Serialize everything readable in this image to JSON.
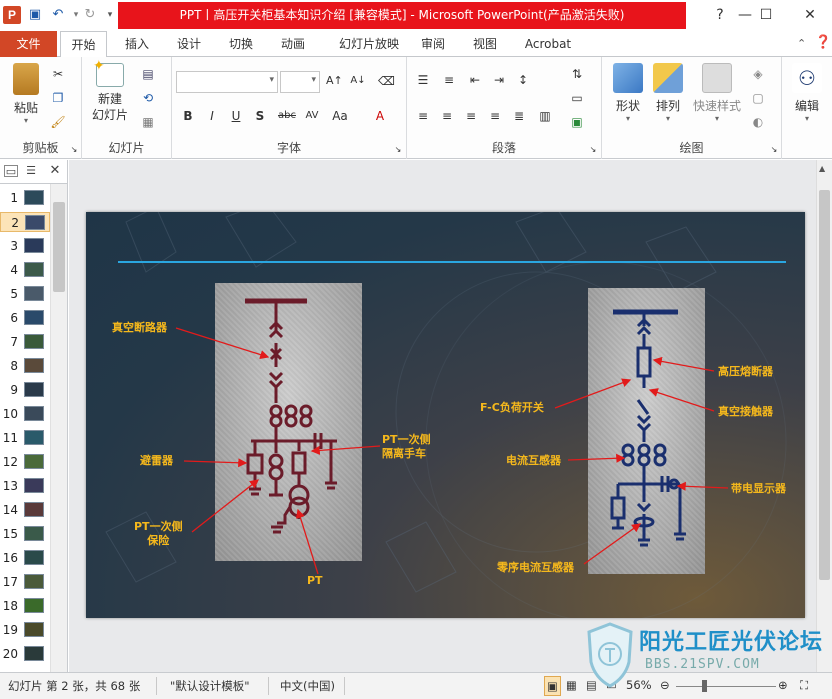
{
  "window": {
    "title": "PPT丨高压开关柜基本知识介绍 [兼容模式] - Microsoft PowerPoint(产品激活失败)",
    "app_icon": "P"
  },
  "ribbon": {
    "file_tab": "文件",
    "tabs": [
      "开始",
      "插入",
      "设计",
      "切换",
      "动画",
      "幻灯片放映",
      "审阅",
      "视图",
      "Acrobat"
    ],
    "active_tab": "开始",
    "groups": {
      "clipboard": {
        "label": "剪贴板",
        "paste": "粘贴"
      },
      "slides": {
        "label": "幻灯片",
        "new_slide": "新建\n幻灯片"
      },
      "font": {
        "label": "字体"
      },
      "paragraph": {
        "label": "段落"
      },
      "drawing": {
        "label": "绘图",
        "shape": "形状",
        "arrange": "排列",
        "quick_styles": "快速样式"
      },
      "editing": {
        "label": "编辑",
        "edit": "编辑"
      }
    }
  },
  "slide_pane": {
    "thumbnails": [
      "1",
      "2",
      "3",
      "4",
      "5",
      "6",
      "7",
      "8",
      "9",
      "10",
      "11",
      "12",
      "13",
      "14",
      "15",
      "16",
      "17",
      "18",
      "19",
      "20"
    ],
    "active_index": 2
  },
  "slide": {
    "left_callouts": {
      "vacuum_breaker": "真空断路器",
      "arrester": "避雷器",
      "pt_primary_fuse": "PT一次侧\n保险",
      "pt": "PT",
      "pt_primary_isolating": "PT一次侧\n隔离手车"
    },
    "right_callouts": {
      "fc_switch": "F-C负荷开关",
      "hv_fuse": "高压熔断器",
      "vacuum_contactor": "真空接触器",
      "current_transformer": "电流互感器",
      "live_display": "带电显示器",
      "zero_seq_ct": "零序电流互感器"
    }
  },
  "statusbar": {
    "slide_info": "幻灯片 第 2 张，共 68 张",
    "theme": "\"默认设计模板\"",
    "language": "中文(中国)",
    "zoom": "56%"
  },
  "watermark": {
    "text": "阳光工匠光伏论坛",
    "url": "BBS.21SPV.COM"
  },
  "colors": {
    "file_tab": "#d24726",
    "title_bar_highlight": "#e8141b",
    "slide_rule": "#2aa6e0",
    "callout_text": "#f5b81c",
    "diagram_left": "#6b1c2a",
    "diagram_right": "#1a2f6e"
  }
}
